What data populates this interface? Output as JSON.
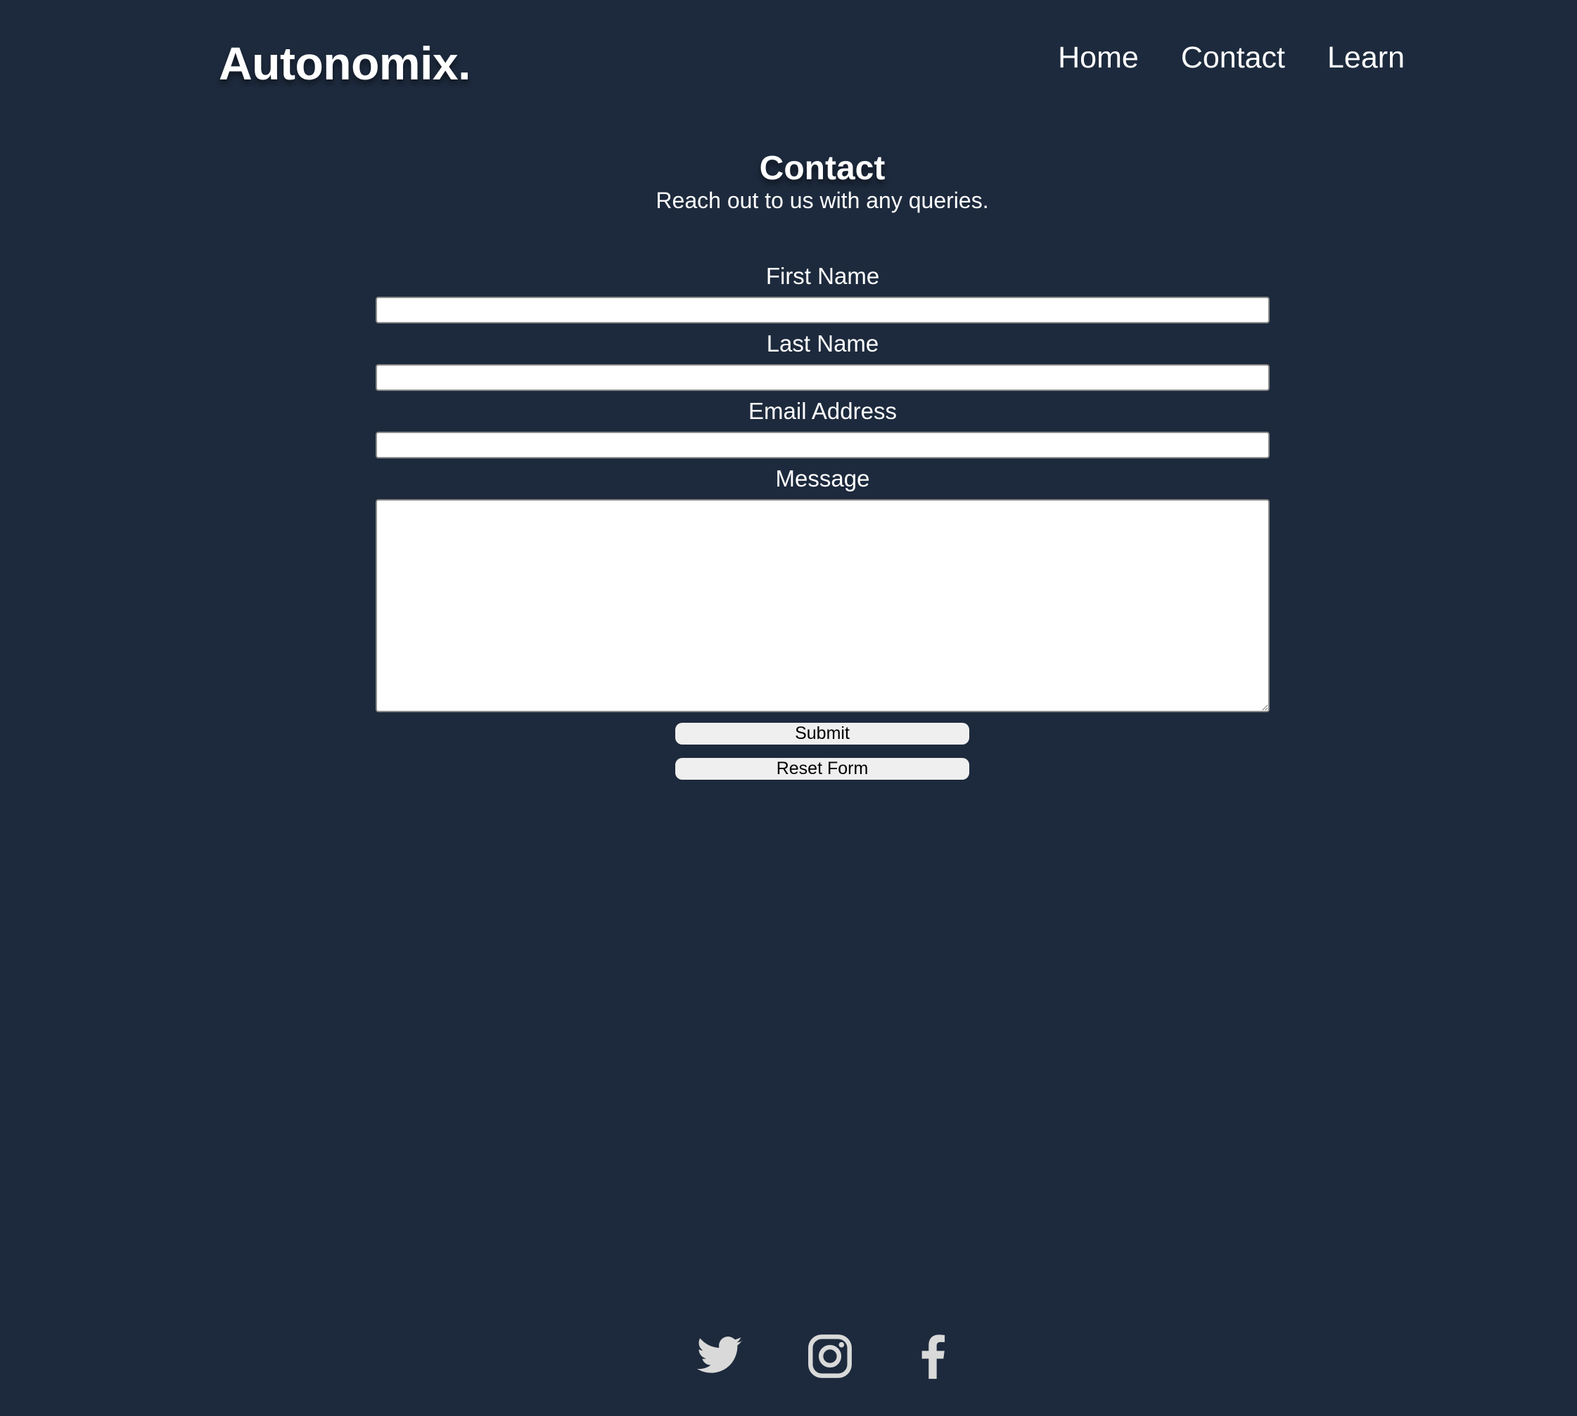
{
  "header": {
    "logo": "Autonomix.",
    "nav": [
      {
        "label": "Home"
      },
      {
        "label": "Contact"
      },
      {
        "label": "Learn"
      }
    ]
  },
  "main": {
    "title": "Contact",
    "subtitle": "Reach out to us with any queries."
  },
  "form": {
    "first_name_label": "First Name",
    "first_name_value": "",
    "last_name_label": "Last Name",
    "last_name_value": "",
    "email_label": "Email Address",
    "email_value": "",
    "message_label": "Message",
    "message_value": "",
    "submit_label": "Submit",
    "reset_label": "Reset Form"
  },
  "footer": {
    "social_icons": [
      "twitter-icon",
      "instagram-icon",
      "facebook-icon"
    ]
  },
  "colors": {
    "background": "#1d2a3d",
    "text": "#ffffff",
    "button_bg": "#efeff0",
    "icon": "#d9d9d9"
  }
}
